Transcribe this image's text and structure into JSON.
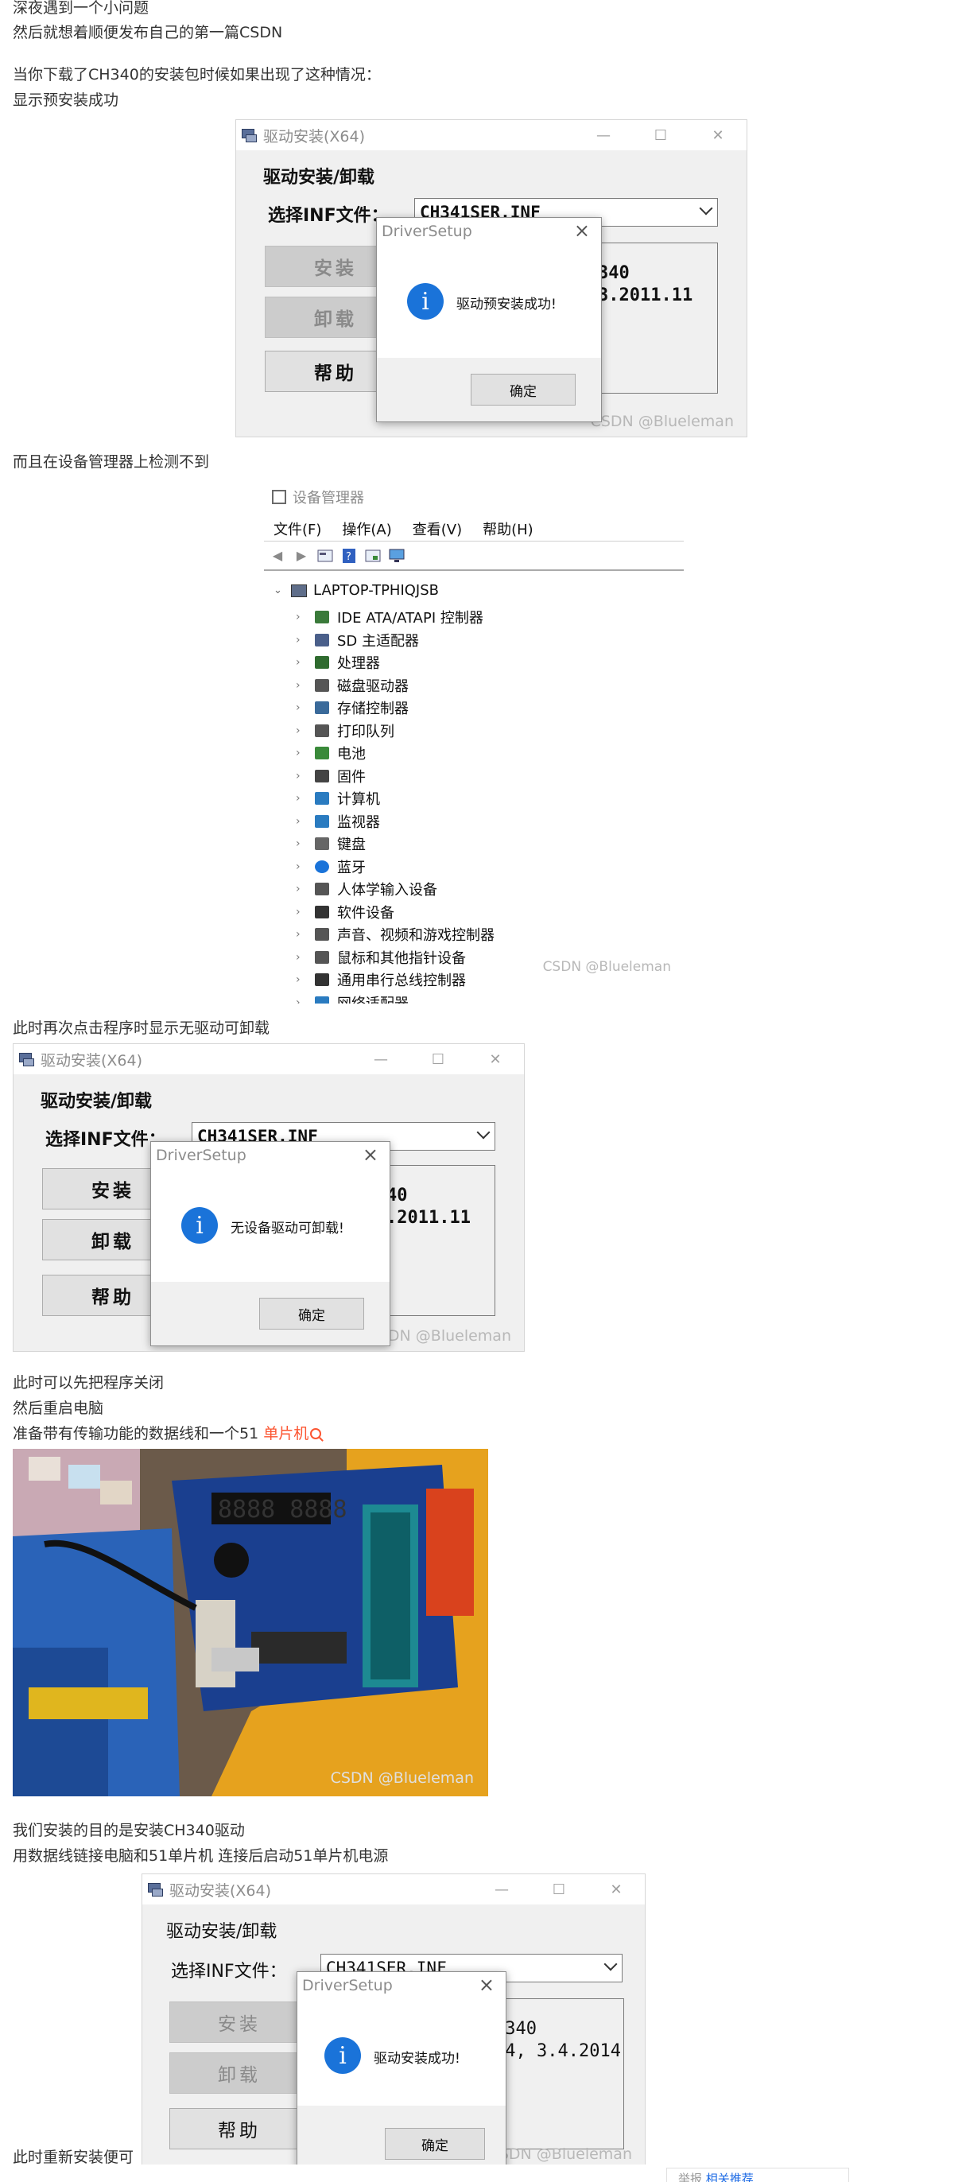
{
  "paragraphs": {
    "p1": "深夜遇到一个小问题",
    "p2": "然后就想着顺便发布自己的第一篇CSDN",
    "p3": "当你下载了CH340的安装包时候如果出现了这种情况：",
    "p4": "显示预安装成功",
    "p5": "而且在设备管理器上检测不到",
    "p6": "此时再次点击程序时显示无驱动可卸载",
    "p7": "此时可以先把程序关闭",
    "p8": "然后重启电脑",
    "p9_prefix": "准备带有传输功能的数据线和一个51 ",
    "p9_link": "单片机",
    "p10": "我们安装的目的是安装CH340驱动",
    "p11": "用数据线链接电脑和51单片机 连接后启动51单片机电源",
    "p12": "此时重新安装便可"
  },
  "screenshot1": {
    "title": "驱动安装(X64)",
    "group_label": "驱动安装/卸载",
    "inf_label": "选择INF文件：",
    "inf_value": "CH341SER.INF",
    "btn_install": "安装",
    "btn_uninstall": "卸载",
    "btn_help": "帮助",
    "info_text": "340\n3.2011.11",
    "dialog_title": "DriverSetup",
    "dialog_message": "驱动预安装成功!",
    "ok_label": "确定",
    "watermark": "CSDN @Blueleman"
  },
  "devmgr": {
    "title": "设备管理器",
    "menu": [
      "文件(F)",
      "操作(A)",
      "查看(V)",
      "帮助(H)"
    ],
    "root": "LAPTOP-TPHIQJSB",
    "items": [
      {
        "label": "IDE ATA/ATAPI 控制器",
        "icon": "ide-icon",
        "color": "#3a7a3a"
      },
      {
        "label": "SD 主适配器",
        "icon": "sd-icon",
        "color": "#4a5f8a"
      },
      {
        "label": "处理器",
        "icon": "cpu-icon",
        "color": "#2f6b2f"
      },
      {
        "label": "磁盘驱动器",
        "icon": "disk-icon",
        "color": "#555555"
      },
      {
        "label": "存储控制器",
        "icon": "storage-icon",
        "color": "#3a6a9a"
      },
      {
        "label": "打印队列",
        "icon": "printer-icon",
        "color": "#555555"
      },
      {
        "label": "电池",
        "icon": "battery-icon",
        "color": "#3a8a3a"
      },
      {
        "label": "固件",
        "icon": "firmware-icon",
        "color": "#444444"
      },
      {
        "label": "计算机",
        "icon": "computer-icon",
        "color": "#2a7bc0"
      },
      {
        "label": "监视器",
        "icon": "monitor-icon",
        "color": "#2a7bc0"
      },
      {
        "label": "键盘",
        "icon": "keyboard-icon",
        "color": "#666666"
      },
      {
        "label": "蓝牙",
        "icon": "bluetooth-icon",
        "color": "#1a73d9"
      },
      {
        "label": "人体学输入设备",
        "icon": "hid-icon",
        "color": "#555555"
      },
      {
        "label": "软件设备",
        "icon": "software-device-icon",
        "color": "#333333"
      },
      {
        "label": "声音、视频和游戏控制器",
        "icon": "audio-icon",
        "color": "#555555"
      },
      {
        "label": "鼠标和其他指针设备",
        "icon": "mouse-icon",
        "color": "#555555"
      },
      {
        "label": "通用串行总线控制器",
        "icon": "usb-icon",
        "color": "#333333"
      },
      {
        "label": "网络适配器",
        "icon": "network-icon",
        "color": "#2a7bc0"
      }
    ],
    "watermark": "CSDN @Blueleman"
  },
  "screenshot2": {
    "title": "驱动安装(X64)",
    "group_label": "驱动安装/卸载",
    "inf_label": "选择INF文件：",
    "inf_value": "CH341SER.INF",
    "btn_install": "安装",
    "btn_uninstall": "卸载",
    "btn_help": "帮助",
    "info_text": "40\n.2011.11",
    "dialog_title": "DriverSetup",
    "dialog_message": "无设备驱动可卸载!",
    "ok_label": "确定",
    "watermark": "CSDN @Blueleman"
  },
  "photo": {
    "watermark": "CSDN @Blueleman",
    "segment_display": "8888 8888"
  },
  "screenshot3": {
    "title": "驱动安装(X64)",
    "group_label": "驱动安装/卸载",
    "inf_label": "选择INF文件：",
    "inf_value": "CH341SER.INF",
    "btn_install": "安装",
    "btn_uninstall": "卸载",
    "btn_help": "帮助",
    "info_text": "H340\n14, 3.4.2014",
    "dialog_title": "DriverSetup",
    "dialog_message": "驱动安装成功!",
    "ok_label": "确定",
    "watermark": "CSDN @Blueleman"
  },
  "bottom_popup": {
    "prefix": "举报   ",
    "link": "相关推荐"
  },
  "colors": {
    "info_icon": "#1a73d9",
    "link": "#fc5531",
    "window_bg": "#f0f0f0"
  }
}
